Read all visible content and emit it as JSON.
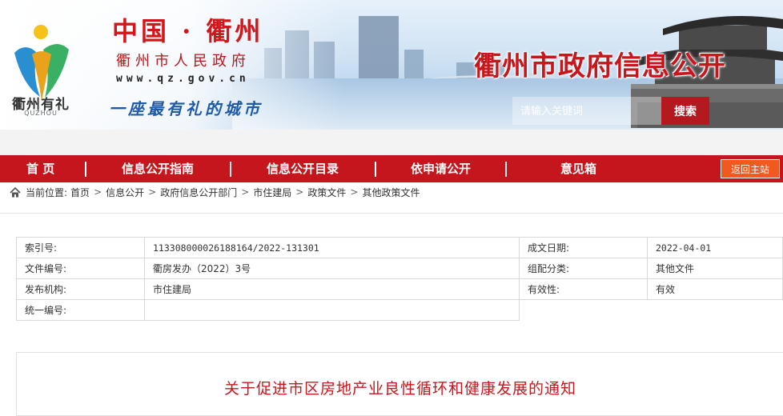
{
  "header": {
    "logo_text": "衢州有礼",
    "logo_sub": "QUZHOU",
    "china_title": "中国 · 衢州",
    "gov_name": "衢州市人民政府",
    "url": "www.qz.gov.cn",
    "slogan": "一座最有礼的城市",
    "site_title": "衢州市政府信息公开",
    "search": {
      "placeholder": "请输入关键词",
      "button_label": "搜索"
    }
  },
  "nav": {
    "items": [
      "首 页",
      "信息公开指南",
      "信息公开目录",
      "依申请公开",
      "意见箱"
    ],
    "back_label": "返回主站"
  },
  "breadcrumb": {
    "prefix": "当前位置:",
    "items": [
      "首页",
      "信息公开",
      "政府信息公开部门",
      "市住建局",
      "政策文件",
      "其他政策文件"
    ]
  },
  "meta": {
    "index_label": "索引号:",
    "index_value": "113308000026188164/2022-131301",
    "date_label": "成文日期:",
    "date_value": "2022-04-01",
    "docno_label": "文件编号:",
    "docno_value": "衢房发办（2022）3号",
    "category_label": "组配分类:",
    "category_value": "其他文件",
    "issuer_label": "发布机构:",
    "issuer_value": "市住建局",
    "validity_label": "有效性:",
    "validity_value": "有效",
    "unified_label": "统一编号:",
    "unified_value": ""
  },
  "document": {
    "title": "关于促进市区房地产业良性循环和健康发展的通知"
  },
  "colors": {
    "brand_red": "#c4161c",
    "back_orange": "#f05a1e",
    "slogan_blue": "#1f5aa6"
  }
}
